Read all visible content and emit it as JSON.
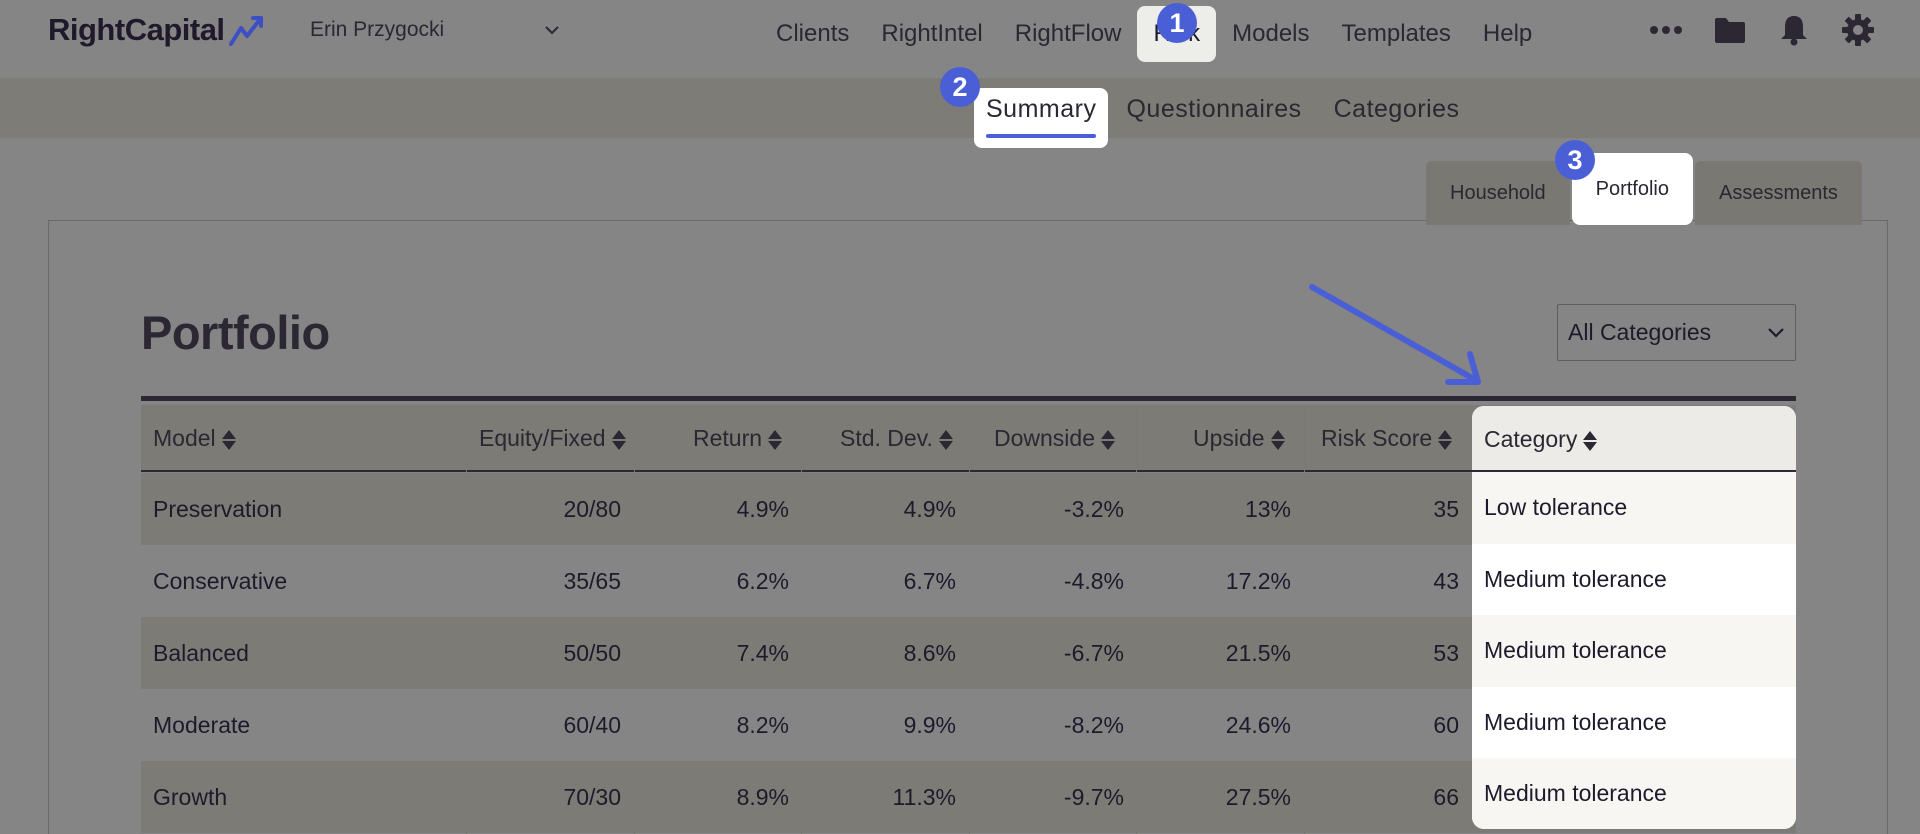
{
  "app": {
    "logo_text": "RightCapital",
    "client_name": "Erin Przygocki"
  },
  "nav": {
    "items": [
      "Clients",
      "RightIntel",
      "RightFlow",
      "Risk",
      "Models",
      "Templates",
      "Help"
    ],
    "active": "Risk",
    "icons": [
      "more-icon",
      "folder-icon",
      "bell-icon",
      "gear-icon"
    ]
  },
  "subnav": {
    "items": [
      "Summary",
      "Questionnaires",
      "Categories"
    ],
    "active": "Summary"
  },
  "view_tabs": {
    "items": [
      "Household",
      "Portfolio",
      "Assessments"
    ],
    "active": "Portfolio"
  },
  "page": {
    "title": "Portfolio",
    "category_filter": "All Categories"
  },
  "table": {
    "headers": [
      "Model",
      "Equity/Fixed",
      "Return",
      "Std. Dev.",
      "Downside",
      "Upside",
      "Risk Score",
      "Category"
    ],
    "rows": [
      {
        "model": "Preservation",
        "equity_fixed": "20/80",
        "return": "4.9%",
        "std_dev": "4.9%",
        "downside": "-3.2%",
        "upside": "13%",
        "risk_score": "35",
        "category": "Low tolerance"
      },
      {
        "model": "Conservative",
        "equity_fixed": "35/65",
        "return": "6.2%",
        "std_dev": "6.7%",
        "downside": "-4.8%",
        "upside": "17.2%",
        "risk_score": "43",
        "category": "Medium tolerance"
      },
      {
        "model": "Balanced",
        "equity_fixed": "50/50",
        "return": "7.4%",
        "std_dev": "8.6%",
        "downside": "-6.7%",
        "upside": "21.5%",
        "risk_score": "53",
        "category": "Medium tolerance"
      },
      {
        "model": "Moderate",
        "equity_fixed": "60/40",
        "return": "8.2%",
        "std_dev": "9.9%",
        "downside": "-8.2%",
        "upside": "24.6%",
        "risk_score": "60",
        "category": "Medium tolerance"
      },
      {
        "model": "Growth",
        "equity_fixed": "70/30",
        "return": "8.9%",
        "std_dev": "11.3%",
        "downside": "-9.7%",
        "upside": "27.5%",
        "risk_score": "66",
        "category": "Medium tolerance"
      }
    ]
  },
  "annotations": {
    "badges": [
      "1",
      "2",
      "3"
    ],
    "accent_color": "#4a5fd6"
  }
}
